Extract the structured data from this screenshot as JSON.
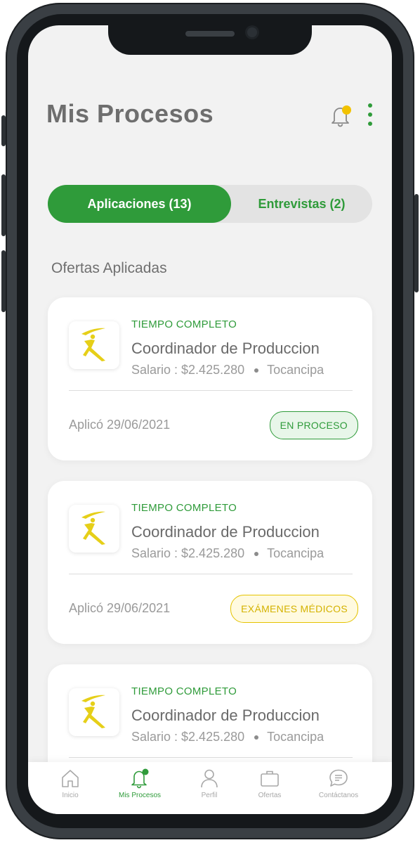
{
  "header": {
    "title": "Mis Procesos"
  },
  "tabs": [
    {
      "label": "Aplicaciones (13)",
      "active": true
    },
    {
      "label": "Entrevistas (2)",
      "active": false
    }
  ],
  "section_title": "Ofertas Aplicadas",
  "cards": [
    {
      "type": "TIEMPO COMPLETO",
      "title": "Coordinador de Produccion",
      "salary": "Salario : $2.425.280",
      "location": "Tocancipa",
      "applied": "Aplicó 29/06/2021",
      "status": "EN PROCESO",
      "status_color": "#2f9b3a"
    },
    {
      "type": "TIEMPO COMPLETO",
      "title": "Coordinador de Produccion",
      "salary": "Salario : $2.425.280",
      "location": "Tocancipa",
      "applied": "Aplicó 29/06/2021",
      "status": "EXÁMENES MÉDICOS",
      "status_color": "#e5c300"
    },
    {
      "type": "TIEMPO COMPLETO",
      "title": "Coordinador de Produccion",
      "salary": "Salario : $2.425.280",
      "location": "Tocancipa"
    }
  ],
  "nav": [
    {
      "label": "Inicio",
      "icon": "home-icon",
      "active": false
    },
    {
      "label": "Mis Procesos",
      "icon": "bell-icon",
      "active": true
    },
    {
      "label": "Perfil",
      "icon": "user-icon",
      "active": false
    },
    {
      "label": "Ofertas",
      "icon": "briefcase-icon",
      "active": false
    },
    {
      "label": "Contáctanos",
      "icon": "chat-icon",
      "active": false
    }
  ],
  "colors": {
    "accent": "#2f9b3a",
    "notification": "#f2c200",
    "warning": "#e5c300"
  }
}
